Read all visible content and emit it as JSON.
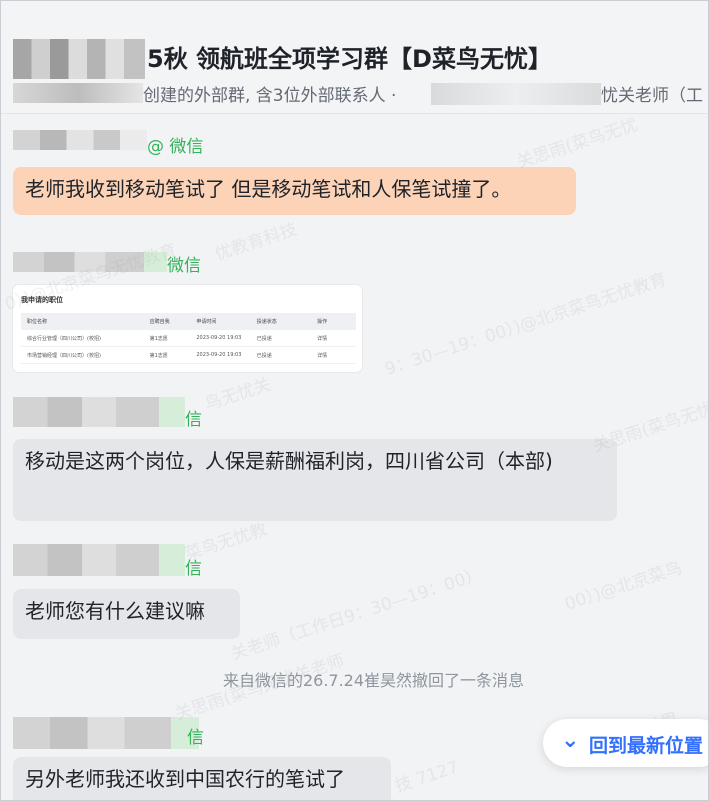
{
  "header": {
    "title": "5秋 领航班全项学习群【D菜鸟无忧】",
    "subtitle": "创建的外部群, 含3位外部联系人 · ",
    "subtitle_tail": "忧关老师（工"
  },
  "messages": [
    {
      "tag": "@ 微信",
      "text": "老师我收到移动笔试了 但是移动笔试和人保笔试撞了。"
    },
    {
      "tag": "微信"
    },
    {
      "tag": "信",
      "text": "移动是这两个岗位，人保是薪酬福利岗，四川省公司（本部)"
    },
    {
      "tag": "信",
      "text": "老师您有什么建议嘛"
    },
    {
      "tag": "信",
      "text": "另外老师我还收到中国农行的笔试了"
    }
  ],
  "card": {
    "title": "我申请的职位",
    "columns": [
      "职位名称",
      "应聘自我",
      "申请时间",
      "投递状态",
      "操作"
    ],
    "rows": [
      [
        "综合行业管理（四川公司）(校招)",
        "第1志愿",
        "2023-09-20 19:03",
        "已投递",
        "详情"
      ],
      [
        "市场营销经理（四川公司）(校招)",
        "第1志愿",
        "2023-09-20 19:03",
        "已投递",
        "详情"
      ]
    ]
  },
  "system_message": "来自微信的26.7.24崔昊然撤回了一条消息",
  "back_to_latest": {
    "icon": "double-chevron-down-icon",
    "label": "回到最新位置"
  },
  "watermarks": [
    "关思雨(菜鸟无忧",
    "优教育科技",
    "0）)@北京菜鸟无忧教育",
    "9：30—19：00）)@北京菜鸟无忧教育",
    "鸟无忧关",
    "关思雨(菜鸟无忧",
    "菜鸟无忧教",
    "00）)@北京菜鸟",
    "关老师（工作日9：30—19：00）",
    "关思雨(菜鸟无忧关老师",
    "关思",
    "技 7127"
  ],
  "bottom_label": "技 7127"
}
